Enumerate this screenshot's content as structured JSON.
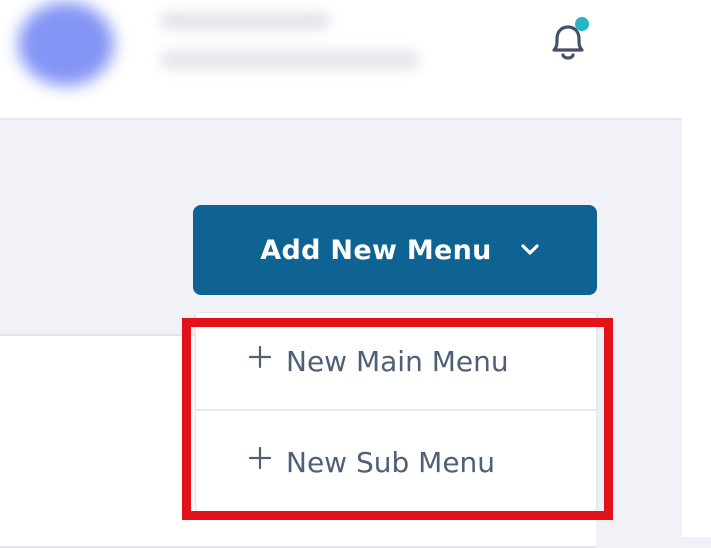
{
  "header": {
    "notification_dot_color": "#2ab3c6"
  },
  "add_menu_button": {
    "label": "Add New Menu",
    "bg_color": "#0f6392"
  },
  "dropdown": {
    "items": [
      {
        "label": "New Main Menu",
        "icon": "plus-icon"
      },
      {
        "label": "New Sub Menu",
        "icon": "plus-icon"
      }
    ]
  },
  "highlight_color": "#e2111a"
}
